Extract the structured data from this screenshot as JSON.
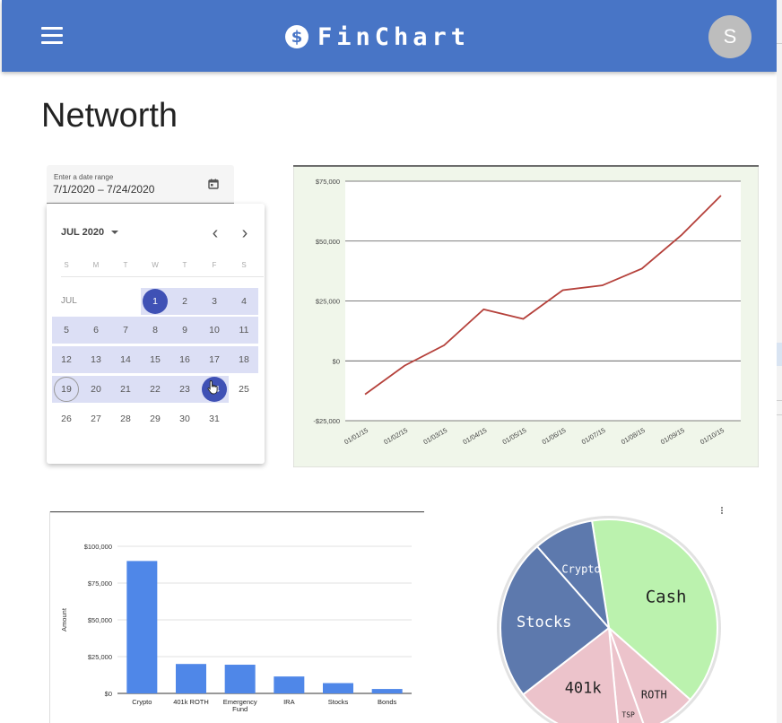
{
  "app": {
    "title": "FinChart",
    "logo_symbol": "$",
    "avatar_initial": "S"
  },
  "page": {
    "title": "Networth"
  },
  "date_range": {
    "label": "Enter a date range",
    "value": "7/1/2020 – 7/24/2020",
    "calendar": {
      "month_label": "JUL 2020",
      "prev_icon": "‹",
      "next_icon": "›",
      "weekdays": [
        "S",
        "M",
        "T",
        "W",
        "T",
        "F",
        "S"
      ],
      "row_label": "JUL",
      "weeks": [
        [
          "",
          "",
          "",
          "1",
          "2",
          "3",
          "4"
        ],
        [
          "5",
          "6",
          "7",
          "8",
          "9",
          "10",
          "11"
        ],
        [
          "12",
          "13",
          "14",
          "15",
          "16",
          "17",
          "18"
        ],
        [
          "19",
          "20",
          "21",
          "22",
          "23",
          "24",
          "25"
        ],
        [
          "26",
          "27",
          "28",
          "29",
          "30",
          "31",
          ""
        ]
      ],
      "range_start": 1,
      "range_end": 24,
      "today": 19
    }
  },
  "chart_data": [
    {
      "type": "line",
      "title": "",
      "x": [
        "01/01/15",
        "01/02/15",
        "01/03/15",
        "01/04/15",
        "01/05/15",
        "01/06/15",
        "01/07/15",
        "01/08/15",
        "01/09/15",
        "01/10/15"
      ],
      "y_ticks": [
        "$75,000",
        "$50,000",
        "$25,000",
        "$0",
        "-$25,000"
      ],
      "ylim": [
        -25000,
        75000
      ],
      "series": [
        {
          "values": [
            -14000,
            -2000,
            6500,
            21500,
            17500,
            29500,
            31500,
            38500,
            52500,
            69000
          ],
          "color": "#b5413b"
        }
      ],
      "background": "#f0f6ea",
      "grid": true
    },
    {
      "type": "bar",
      "categories": [
        "Crypto",
        "401k ROTH",
        "Emergency Fund",
        "IRA",
        "Stocks",
        "Bonds"
      ],
      "values": [
        90000,
        20000,
        19500,
        11500,
        7000,
        3000
      ],
      "ylabel": "Amount",
      "y_ticks": [
        "$100,000",
        "$75,000",
        "$50,000",
        "$25,000",
        "$0"
      ],
      "ylim": [
        0,
        100000
      ],
      "color": "#4f87e8",
      "grid": true
    },
    {
      "type": "pie",
      "slices": [
        {
          "label": "Cash",
          "value": 39,
          "color": "#bbf2ae"
        },
        {
          "label": "ROTH",
          "value": 8,
          "color": "#ecc3cb"
        },
        {
          "label": "TSP",
          "value": 4,
          "color": "#ecc3cb"
        },
        {
          "label": "401k",
          "value": 16,
          "color": "#ecc3cb"
        },
        {
          "label": "Stocks",
          "value": 24,
          "color": "#5d79ad"
        },
        {
          "label": "Crypto",
          "value": 9,
          "color": "#5d79ad"
        }
      ]
    }
  ]
}
